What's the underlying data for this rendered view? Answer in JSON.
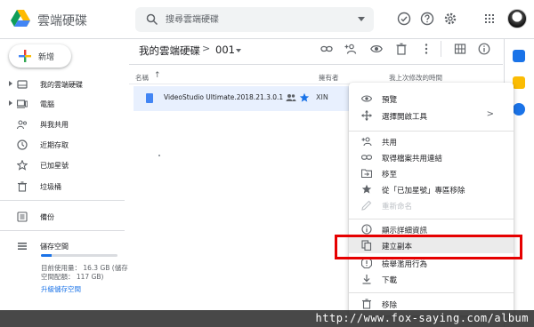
{
  "header": {
    "app_title": "雲端硬碟",
    "search_placeholder": "搜尋雲端硬碟"
  },
  "sidebar": {
    "new_label": "新增",
    "items": [
      {
        "label": "我的雲端硬碟",
        "icon": "drive-icon"
      },
      {
        "label": "電腦",
        "icon": "computer-icon"
      },
      {
        "label": "與我共用",
        "icon": "shared-with-me-icon"
      },
      {
        "label": "近期存取",
        "icon": "clock-icon"
      },
      {
        "label": "已加星號",
        "icon": "star-outline-icon"
      },
      {
        "label": "垃圾桶",
        "icon": "trash-icon"
      },
      {
        "label": "備份",
        "icon": "backup-icon"
      },
      {
        "label": "儲存空間",
        "icon": "storage-icon"
      }
    ],
    "storage": {
      "used_line1": "目前使用量： 16.3 GB (儲存",
      "used_line2": "空間配額： 117 GB)",
      "upgrade_link": "升級儲存空間",
      "fill_fraction": 0.14
    }
  },
  "main": {
    "breadcrumb_root": "我的雲端硬碟",
    "breadcrumb_sep": ">",
    "breadcrumb_current": "001",
    "columns": {
      "name": "名稱",
      "owner": "擁有者",
      "modified": "我上次修改的時間"
    },
    "sort_arrow": "↑",
    "file": {
      "name": "VideoStudio Ultimate.2018.21.3.0.14...",
      "owner": "XIN"
    }
  },
  "context_menu": {
    "items": [
      {
        "label": "預覽",
        "icon": "eye-icon"
      },
      {
        "label": "選擇開啟工具",
        "icon": "open-with-icon",
        "submenu": ">"
      },
      {
        "label": "共用",
        "icon": "add-person-icon"
      },
      {
        "label": "取得檔案共用連結",
        "icon": "link-icon"
      },
      {
        "label": "移至",
        "icon": "move-to-folder-icon"
      },
      {
        "label": "從「已加星號」專區移除",
        "icon": "star-filled-icon"
      },
      {
        "label": "重新命名",
        "icon": "pencil-icon",
        "disabled": true
      },
      {
        "label": "顯示詳細資訊",
        "icon": "info-icon"
      },
      {
        "label": "建立副本",
        "icon": "copy-icon"
      },
      {
        "label": "檢舉濫用行為",
        "icon": "report-icon"
      },
      {
        "label": "下載",
        "icon": "download-icon"
      },
      {
        "label": "移除",
        "icon": "trash-icon"
      }
    ]
  },
  "watermark": "http://www.fox-saying.com/album",
  "colors": {
    "accent_blue": "#1a73e8",
    "selected_row": "#e8f0fe",
    "highlight_box": "#e60000",
    "text_primary": "#202124",
    "text_secondary": "#5f6368"
  }
}
